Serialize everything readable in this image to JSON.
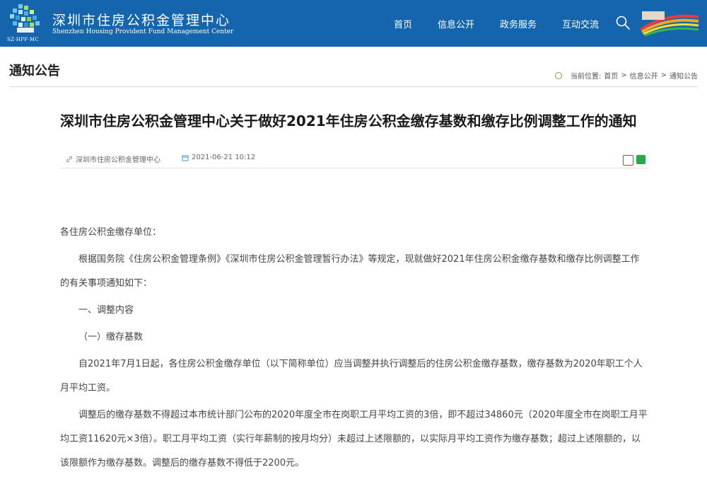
{
  "header": {
    "site_name_cn": "深圳市住房公积金管理中心",
    "site_name_en": "Shenzhen Housing Provident Fund Management Center",
    "logo_caption": "SZ·HPF·MC",
    "nav": [
      "首页",
      "信息公开",
      "政务服务",
      "互动交流"
    ],
    "bg_color": "#1565ad"
  },
  "page": {
    "title": "通知公告",
    "breadcrumb_prefix": "当前位置:",
    "breadcrumb": [
      "首页",
      "信息公开",
      "通知公告"
    ],
    "breadcrumb_sep": ">"
  },
  "article": {
    "title": "深圳市住房公积金管理中心关于做好2021年住房公积金缴存基数和缴存比例调整工作的通知",
    "source": "深圳市住房公积金管理中心",
    "date": "2021-06-21 10:12",
    "paragraphs": [
      "各住房公积金缴存单位：",
      "根据国务院《住房公积金管理条例》《深圳市住房公积金管理暂行办法》等规定，现就做好2021年住房公积金缴存基数和缴存比例调整工作的有关事项通知如下：",
      "一、调整内容",
      "（一）缴存基数",
      "自2021年7月1日起，各住房公积金缴存单位（以下简称单位）应当调整并执行调整后的住房公积金缴存基数，缴存基数为2020年职工个人月平均工资。",
      "调整后的缴存基数不得超过本市统计部门公布的2020年度全市在岗职工月平均工资的3倍，即不超过34860元（2020年度全市在岗职工月平均工资11620元×3倍）。职工月平均工资（实行年薪制的按月均分）未超过上述限额的，以实际月平均工资作为缴存基数；超过上述限额的，以该限额作为缴存基数。调整后的缴存基数不得低于2200元。"
    ]
  }
}
